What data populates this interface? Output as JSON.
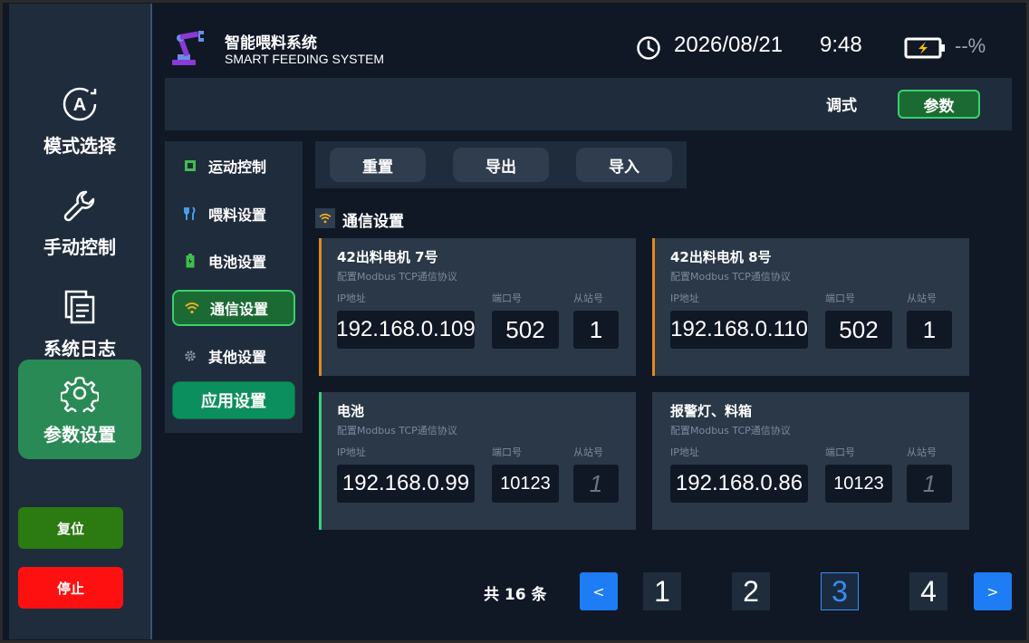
{
  "app": {
    "title": "智能喂料系统",
    "subtitle": "SMART FEEDING SYSTEM",
    "date": "2026/08/21",
    "time": "9:48",
    "battery_level": "--%"
  },
  "leftnav": {
    "items": [
      {
        "label": "模式选择",
        "icon": "mode-select-icon"
      },
      {
        "label": "手动控制",
        "icon": "wrench-icon"
      },
      {
        "label": "系统日志",
        "icon": "log-icon"
      },
      {
        "label": "参数设置",
        "icon": "gear-icon",
        "active": true
      }
    ],
    "reset_label": "复位",
    "stop_label": "停止"
  },
  "modebar": {
    "debug_label": "调式",
    "param_label": "参数"
  },
  "submenu": {
    "items": [
      {
        "label": "运动控制",
        "icon": "chip-icon"
      },
      {
        "label": "喂料设置",
        "icon": "feed-icon"
      },
      {
        "label": "电池设置",
        "icon": "battery-icon"
      },
      {
        "label": "通信设置",
        "icon": "wifi-icon",
        "active": true
      },
      {
        "label": "其他设置",
        "icon": "gear-icon"
      }
    ],
    "apply_label": "应用设置"
  },
  "toolbar": {
    "reset_label": "重置",
    "export_label": "导出",
    "import_label": "导入"
  },
  "section": {
    "title": "通信设置"
  },
  "labels": {
    "ip": "IP地址",
    "port": "端口号",
    "slave": "从站号"
  },
  "cards": [
    {
      "title": "42出料电机 7号",
      "desc": "配置Modbus TCP通信协议",
      "ip": "192.168.0.109",
      "port": "502",
      "slave": "1",
      "accent": "#e08a1e"
    },
    {
      "title": "42出料电机 8号",
      "desc": "配置Modbus TCP通信协议",
      "ip": "192.168.0.110",
      "port": "502",
      "slave": "1",
      "accent": "#e08a1e"
    },
    {
      "title": "电池",
      "desc": "配置Modbus TCP通信协议",
      "ip": "192.168.0.99",
      "port": "10123",
      "slave": "1",
      "accent": "#3ad07a"
    },
    {
      "title": "报警灯、料箱",
      "desc": "配置Modbus TCP通信协议",
      "ip": "192.168.0.86",
      "port": "10123",
      "slave": "1",
      "accent": ""
    }
  ],
  "pagination": {
    "total": "共 16 条",
    "prev": "<",
    "next": ">",
    "pages": [
      "1",
      "2",
      "3",
      "4"
    ],
    "current": "3"
  },
  "colors": {
    "background": "#101826",
    "panel": "#1f2c3c",
    "card": "#2a3848",
    "active_green": "#2a8a55",
    "stop_red": "#ff1010",
    "reset_green": "#2b7a12",
    "accent_blue": "#1e7cf5",
    "accent_orange": "#e08a1e"
  }
}
